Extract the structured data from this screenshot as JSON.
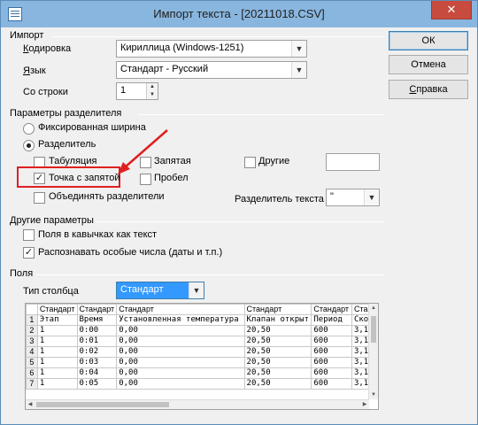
{
  "window": {
    "title": "Импорт текста - [20211018.CSV]",
    "close_glyph": "✕"
  },
  "import": {
    "section": "Импорт",
    "encoding_label": "Кодировка",
    "encoding_value": "Кириллица (Windows-1251)",
    "language_label": "Язык",
    "language_value": "Стандарт - Русский",
    "from_row_label": "Со строки",
    "from_row_value": "1"
  },
  "buttons": {
    "ok": "ОК",
    "cancel": "Отмена",
    "help": "Справка"
  },
  "separator": {
    "section": "Параметры разделителя",
    "fixed_width": "Фиксированная ширина",
    "separated": "Разделитель",
    "tab": "Табуляция",
    "comma": "Запятая",
    "other": "Другие",
    "semicolon": "Точка с запятой",
    "space": "Пробел",
    "merge": "Объединять разделители",
    "text_delim_label": "Разделитель текста",
    "text_delim_value": "\"",
    "checked": {
      "tab": false,
      "comma": false,
      "other": false,
      "semicolon": true,
      "space": false,
      "merge": false
    },
    "mode": "separated"
  },
  "other_params": {
    "section": "Другие параметры",
    "quoted_as_text": "Поля в кавычках как текст",
    "detect_special": "Распознавать особые числа (даты и т.п.)",
    "checked": {
      "quoted_as_text": false,
      "detect_special": true
    }
  },
  "fields": {
    "section": "Поля",
    "col_type_label": "Тип столбца",
    "col_type_value": "Стандарт"
  },
  "preview": {
    "headers": [
      "Стандарт",
      "Стандарт",
      "Стандарт",
      "Стандарт",
      "Стандарт",
      "Ста"
    ],
    "rows": [
      [
        "1",
        "Этап",
        "Время",
        "Установленная температура",
        "Клапан открыт",
        "Период",
        "Скор"
      ],
      [
        "2",
        "1",
        "0:00",
        "0,00",
        "20,50",
        "600",
        "3,1"
      ],
      [
        "3",
        "1",
        "0:01",
        "0,00",
        "20,50",
        "600",
        "3,1"
      ],
      [
        "4",
        "1",
        "0:02",
        "0,00",
        "20,50",
        "600",
        "3,1"
      ],
      [
        "5",
        "1",
        "0:03",
        "0,00",
        "20,50",
        "600",
        "3,1"
      ],
      [
        "6",
        "1",
        "0:04",
        "0,00",
        "20,50",
        "600",
        "3,1"
      ],
      [
        "7",
        "1",
        "0:05",
        "0,00",
        "20,50",
        "600",
        "3,1"
      ]
    ]
  },
  "colors": {
    "highlight": "#e02020",
    "titlebar": "#89b6de",
    "selected": "#3399ff"
  }
}
